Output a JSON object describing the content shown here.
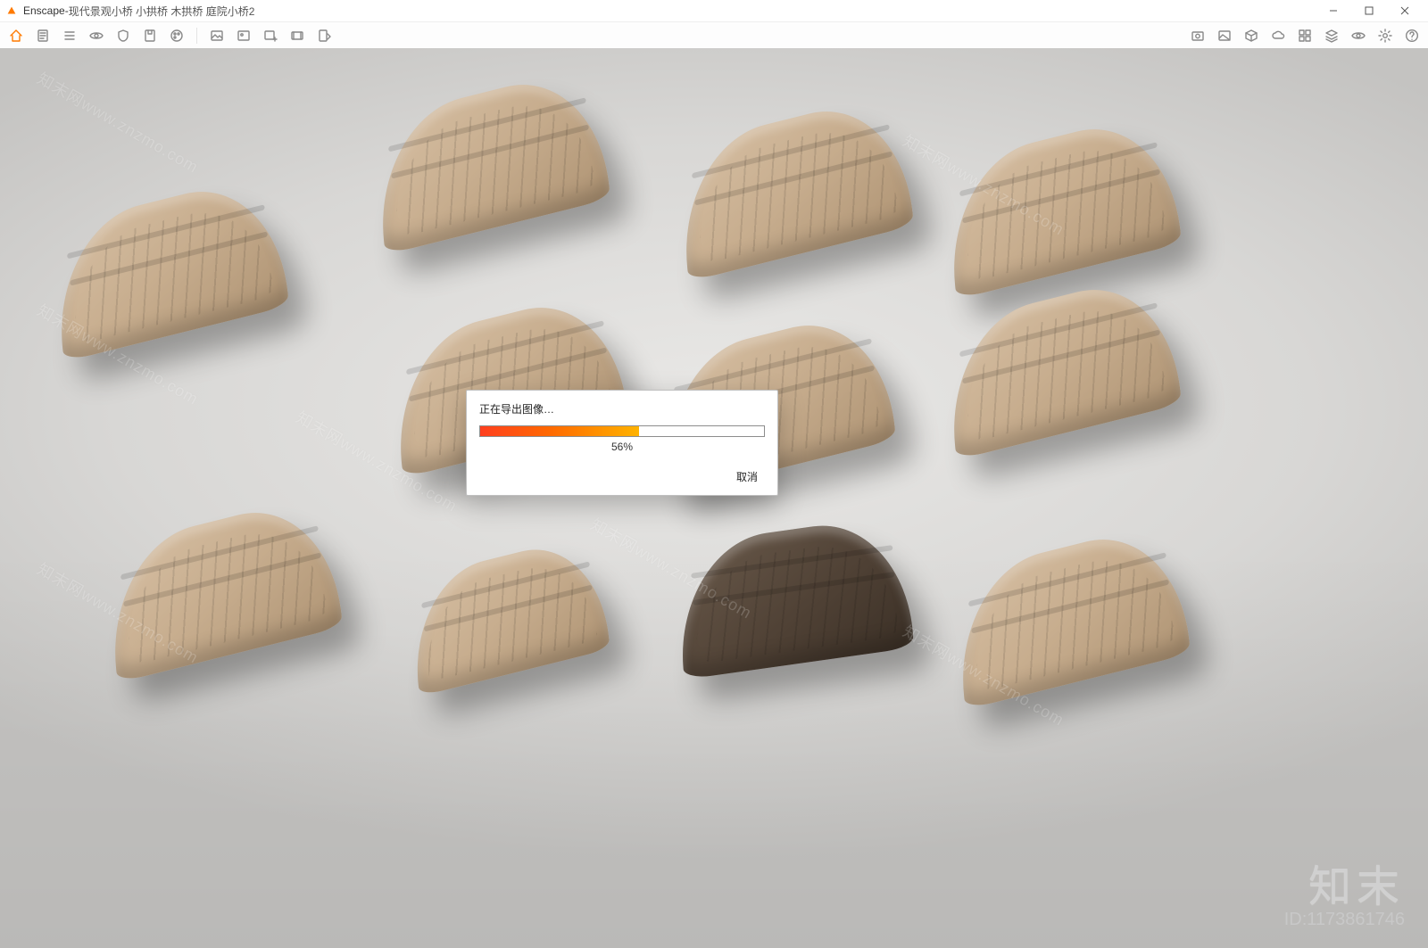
{
  "window": {
    "app_name": "Enscape",
    "document_title": "现代景观小桥 小拱桥 木拱桥 庭院小桥2",
    "title_separator": " - "
  },
  "window_controls": {
    "minimize": "minimize",
    "maximize": "maximize",
    "close": "close"
  },
  "toolbar_left_icons": [
    "home-icon",
    "page-icon",
    "list-icon",
    "eye-icon",
    "shield-icon",
    "save-icon",
    "palette-icon"
  ],
  "toolbar_mid_icons": [
    "image-a-icon",
    "image-b-icon",
    "image-plus-icon",
    "film-icon",
    "export-icon"
  ],
  "toolbar_right_icons": [
    "capture-icon",
    "image-icon",
    "cube-icon",
    "cloud-icon",
    "grid-icon",
    "layers-icon",
    "visibility-icon",
    "settings-icon",
    "help-icon"
  ],
  "progress_dialog": {
    "title": "正在导出图像…",
    "percent_value": 56,
    "percent_label": "56%",
    "cancel_label": "取消"
  },
  "watermark_text": "知末网www.znzmo.com",
  "brand": {
    "logo_text": "知末",
    "id_label": "ID:1173861746"
  },
  "colors": {
    "accent_start": "#ff3f1f",
    "accent_end": "#ffb300",
    "toolbar_icon": "#888888",
    "home_icon": "#ff7a00"
  },
  "viewport": {
    "description": "3D render of multiple wooden arched garden bridges on a light grey studio floor",
    "bridge_count": 11
  }
}
